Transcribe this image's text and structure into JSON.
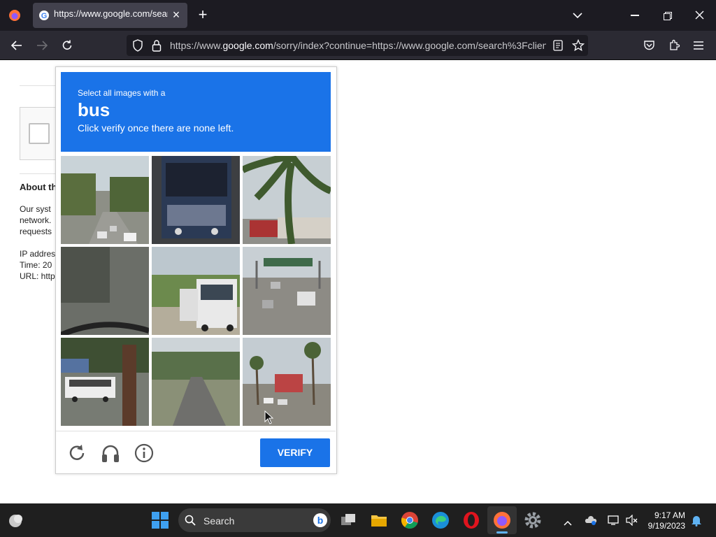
{
  "browser": {
    "tab_title": "https://www.google.com/search",
    "url_prefix": "https://www.",
    "url_domain": "google.com",
    "url_rest": "/sorry/index?continue=https://www.google.com/search%3Fclien",
    "new_tab_label": "+",
    "close_tab_label": "×"
  },
  "page": {
    "about_heading": "About th",
    "body_lines": [
      "Our syst",
      "network.",
      "requests"
    ],
    "ip_label": "IP addres",
    "time_label": "Time: 20",
    "url_label": "URL: http"
  },
  "captcha": {
    "small_text": "Select all images with a",
    "target": "bus",
    "instruction": "Click verify once there are none left.",
    "verify_label": "VERIFY",
    "tiles": [
      {
        "name": "tile-road-trees",
        "selected": false
      },
      {
        "name": "tile-bus-rear",
        "selected": false
      },
      {
        "name": "tile-palm-tree",
        "selected": false
      },
      {
        "name": "tile-dark-ground",
        "selected": false
      },
      {
        "name": "tile-bus-front",
        "selected": false
      },
      {
        "name": "tile-highway",
        "selected": false
      },
      {
        "name": "tile-shuttle-bus",
        "selected": false
      },
      {
        "name": "tile-empty-road",
        "selected": false
      },
      {
        "name": "tile-palm-street",
        "selected": false
      }
    ],
    "footer_icons": [
      "reload-icon",
      "headphones-icon",
      "info-icon"
    ]
  },
  "taskbar": {
    "search_placeholder": "Search",
    "time": "9:17 AM",
    "date": "9/19/2023",
    "colors": {
      "accent": "#1a73e8",
      "taskbar_bg": "#1f1f1f"
    }
  }
}
